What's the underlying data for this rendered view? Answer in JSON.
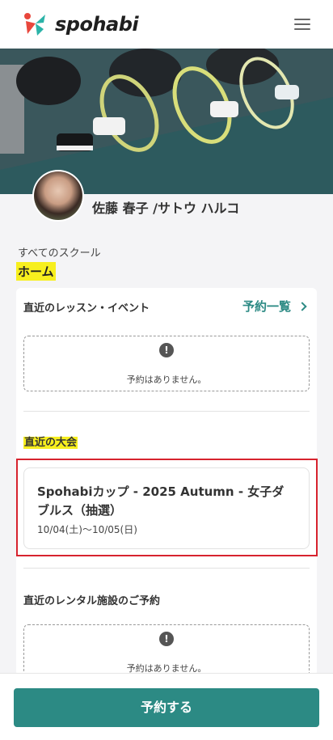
{
  "header": {
    "logo_text": "spohabi",
    "menu_icon": "hamburger-menu-icon"
  },
  "profile": {
    "name": "佐藤 春子 /サトウ ハルコ"
  },
  "breadcrumb": "すべてのスクール",
  "page_title": "ホーム",
  "lessons": {
    "heading": "直近のレッスン・イベント",
    "link_label": "予約一覧",
    "empty_message": "予約はありません。"
  },
  "tournaments": {
    "heading": "直近の大会",
    "items": [
      {
        "title": "Spohabiカップ - 2025 Autumn - 女子ダブルス（抽選）",
        "date": "10/04(土)〜10/05(日)"
      }
    ]
  },
  "rentals": {
    "heading": "直近のレンタル施設のご予約",
    "empty_message": "予約はありません。"
  },
  "footer": {
    "cta_label": "予約する"
  },
  "colors": {
    "accent": "#2c8a84",
    "highlight": "#f7ef1e",
    "selection_frame": "#d7232e"
  }
}
